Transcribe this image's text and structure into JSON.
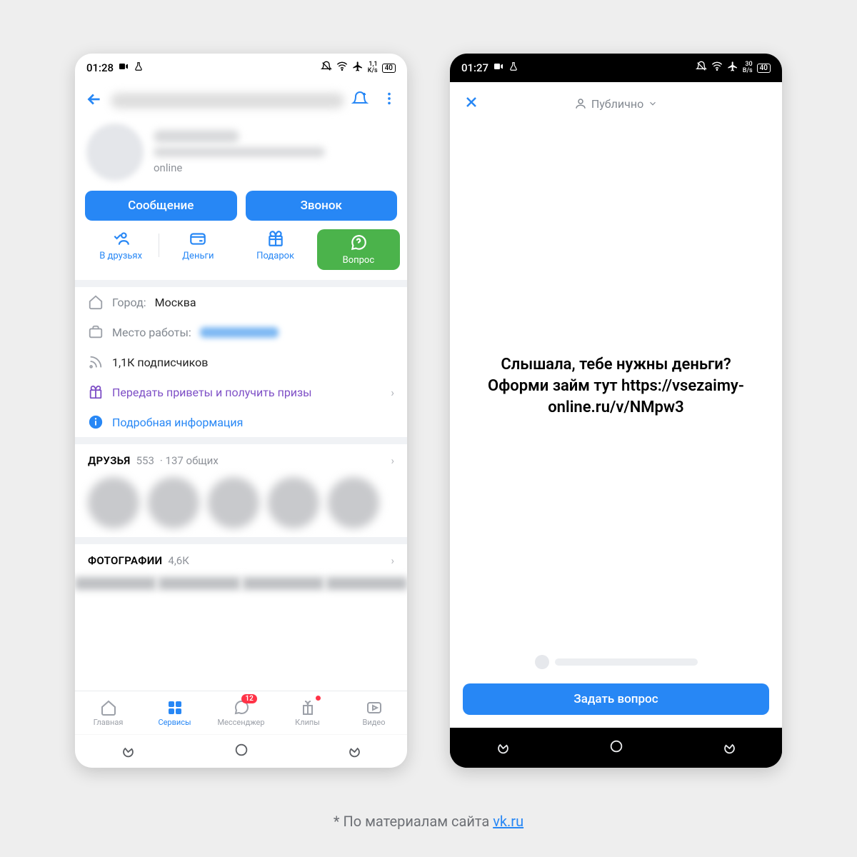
{
  "left": {
    "status": {
      "time": "01:28",
      "net": "1,1",
      "netUnit": "K/s",
      "batt": "40"
    },
    "profile": {
      "online": "online"
    },
    "buttons": {
      "msg": "Сообщение",
      "call": "Звонок"
    },
    "actions": {
      "friends": "В друзьях",
      "money": "Деньги",
      "gift": "Подарок",
      "question": "Вопрос"
    },
    "info": {
      "cityLabel": "Город:",
      "city": "Москва",
      "workLabel": "Место работы:",
      "subs": "1,1К подписчиков",
      "promo": "Передать приветы и получить призы",
      "more": "Подробная информация"
    },
    "friends": {
      "title": "ДРУЗЬЯ",
      "count": "553",
      "mutual": "· 137 общих"
    },
    "photos": {
      "title": "ФОТОГРАФИИ",
      "count": "4,6К"
    },
    "nav": {
      "home": "Главная",
      "services": "Сервисы",
      "messenger": "Мессенджер",
      "clips": "Клипы",
      "video": "Видео",
      "badge": "12"
    }
  },
  "right": {
    "status": {
      "time": "01:27",
      "net": "30",
      "netUnit": "B/s",
      "batt": "40"
    },
    "audience": "Публично",
    "message": "Слышала, тебе нужны деньги? Оформи займ тут https://vsezaimy-online.ru/v/NMpw3",
    "ask": "Задать вопрос"
  },
  "caption": {
    "prefix": "* По материалам сайта ",
    "link": "vk.ru"
  }
}
